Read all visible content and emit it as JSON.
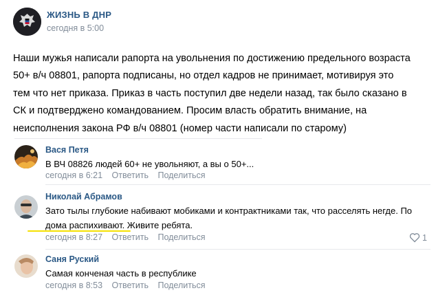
{
  "post": {
    "group_name": "ЖИЗНЬ В ДНР",
    "time": "сегодня в 5:00",
    "text_lines": [
      "Наши мужья написали рапорта на увольнения по достижению предельного возраста",
      "50+ в/ч 08801, рапорта подписаны, но отдел кадров не принимает, мотивируя это",
      "тем что нет приказа. Приказ в часть поступил две недели назад, так было сказано в",
      "СК и подтверджено командованием. Просим власть обратить внимание, на",
      "неисполнения закона РФ в/ч 08801 (номер части написали по старому)"
    ]
  },
  "comments": [
    {
      "author": "Вася Петя",
      "lines": [
        "В ВЧ 08826 людей 60+ не увольняют, а вы о 50+..."
      ],
      "time": "сегодня в 6:21",
      "reply": "Ответить",
      "share": "Поделиться"
    },
    {
      "author": "Николай Абрамов",
      "lines": [
        "Зато тылы глубокие набивают мобиками и контрактниками так, что расселять негде. По",
        "дома распихивают. Живите ребята."
      ],
      "time": "сегодня в 8:27",
      "reply": "Ответить",
      "share": "Поделиться",
      "likes": "1"
    },
    {
      "author": "Саня Руский",
      "lines": [
        "Самая конченая часть в республике"
      ],
      "time": "сегодня в 8:53",
      "reply": "Ответить",
      "share": "Поделиться"
    }
  ],
  "colors": {
    "link": "#2a5885",
    "meta": "#818c99",
    "divider": "#e7e8ec",
    "highlight": "#f5e000"
  }
}
